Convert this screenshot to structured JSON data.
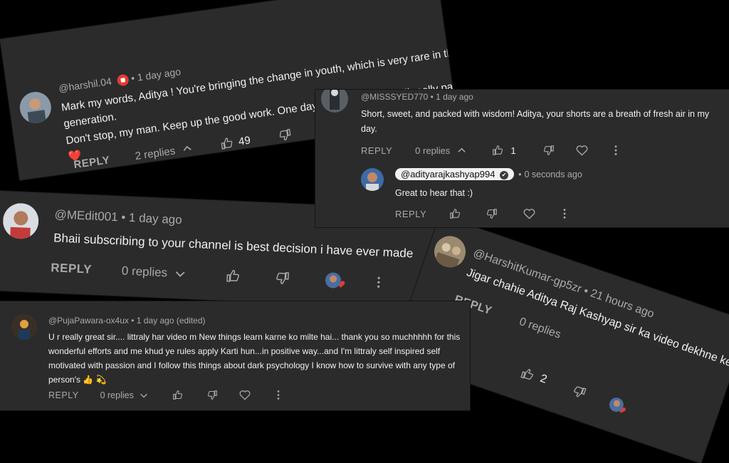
{
  "comments": [
    {
      "handle": "@harshil.04",
      "time": "1 day ago",
      "text1": "Mark my words, Aditya ! You're bringing the change in youth, which is very rare in this",
      "text2": "generation.",
      "text3": "Don't stop, my man. Keep up the good work. One day, your hard work  will really pay off ..",
      "emoji": "❤️",
      "reply_label": "REPLY",
      "replies": "2 replies",
      "likes": "49"
    },
    {
      "handle": "@MISSSYED770",
      "time": "1 day ago",
      "text1": "Short, sweet, and packed with wisdom! Aditya, your shorts are a breath of fresh air in my",
      "text2": "day.",
      "reply_label": "REPLY",
      "replies": "0 replies",
      "likes": "1",
      "nested_reply": {
        "handle": "@adityarajkashyap994",
        "verified": "✔",
        "time": "0 seconds ago",
        "text": "Great to hear that :)",
        "reply_label": "REPLY"
      }
    },
    {
      "handle": "@MEdit001",
      "time": "1 day ago",
      "text": "Bhaii subscribing to your channel is best decision i have ever made",
      "reply_label": "REPLY",
      "replies": "0 replies"
    },
    {
      "handle": "@HarshitKumar-gp5zr",
      "time": "21 hours ago",
      "text": "Jigar chahie Aditya Raj Kashyap sir ka video dekhne ke liye",
      "reply_label": "REPLY",
      "replies": "0 replies",
      "likes": "2"
    },
    {
      "handle": "@PujaPawara-ox4ux",
      "time": "1 day ago (edited)",
      "text1": "U r really great sir.... littraly har video m New things learn karne ko milte hai... thank you so muchhhhh for this",
      "text2": "wonderful efforts and me khud ye rules apply Karti hun...in positive way...and I'm littraly self inspired self",
      "text3": "motivated with passion and I follow this things about dark psychology I know how to survive with any type of",
      "text4": "person's 👍 💫",
      "reply_label": "REPLY",
      "replies": "0 replies"
    }
  ],
  "colors": {
    "background": "#000000",
    "card": "#2b2b2b",
    "text": "#f1f1f1",
    "muted": "#aaaaaa"
  },
  "icons": [
    "thumbs-up-icon",
    "thumbs-down-icon",
    "heart-icon",
    "more-vert-icon",
    "chevron-up-icon",
    "chevron-down-icon"
  ]
}
